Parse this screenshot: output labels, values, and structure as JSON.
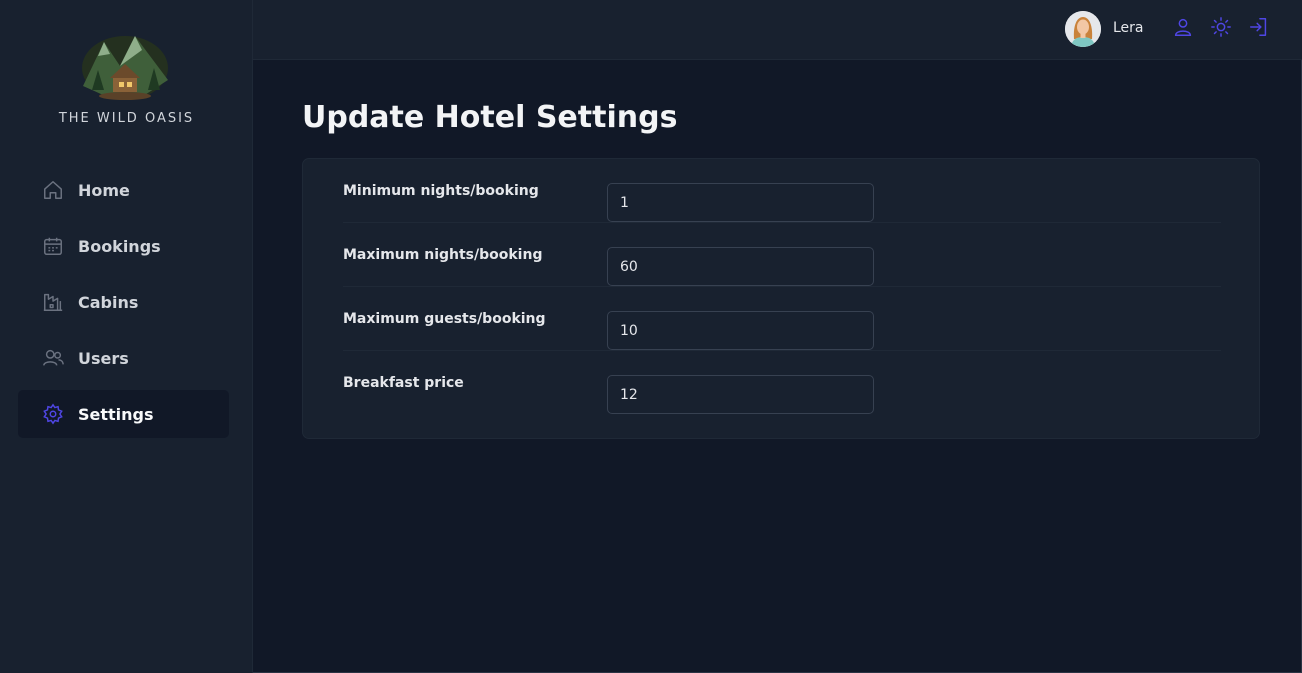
{
  "brand": {
    "name": "THE WILD OASIS",
    "logo_icon": "cabin-in-mountains-logo"
  },
  "sidebar": {
    "items": [
      {
        "label": "Home",
        "icon": "home-icon",
        "active": false
      },
      {
        "label": "Bookings",
        "icon": "calendar-icon",
        "active": false
      },
      {
        "label": "Cabins",
        "icon": "cabin-icon",
        "active": false
      },
      {
        "label": "Users",
        "icon": "users-icon",
        "active": false
      },
      {
        "label": "Settings",
        "icon": "gear-icon",
        "active": true
      }
    ]
  },
  "header": {
    "user_name": "Lera",
    "buttons": [
      "user-icon",
      "sun-icon",
      "logout-icon"
    ]
  },
  "page": {
    "title": "Update Hotel Settings"
  },
  "settings": {
    "fields": [
      {
        "label": "Minimum nights/booking",
        "value": "1"
      },
      {
        "label": "Maximum nights/booking",
        "value": "60"
      },
      {
        "label": "Maximum guests/booking",
        "value": "10"
      },
      {
        "label": "Breakfast price",
        "value": "12"
      }
    ]
  },
  "colors": {
    "background": "#111827",
    "panel": "#18212f",
    "accent": "#4f46e5",
    "text": "#f3f4f6"
  }
}
